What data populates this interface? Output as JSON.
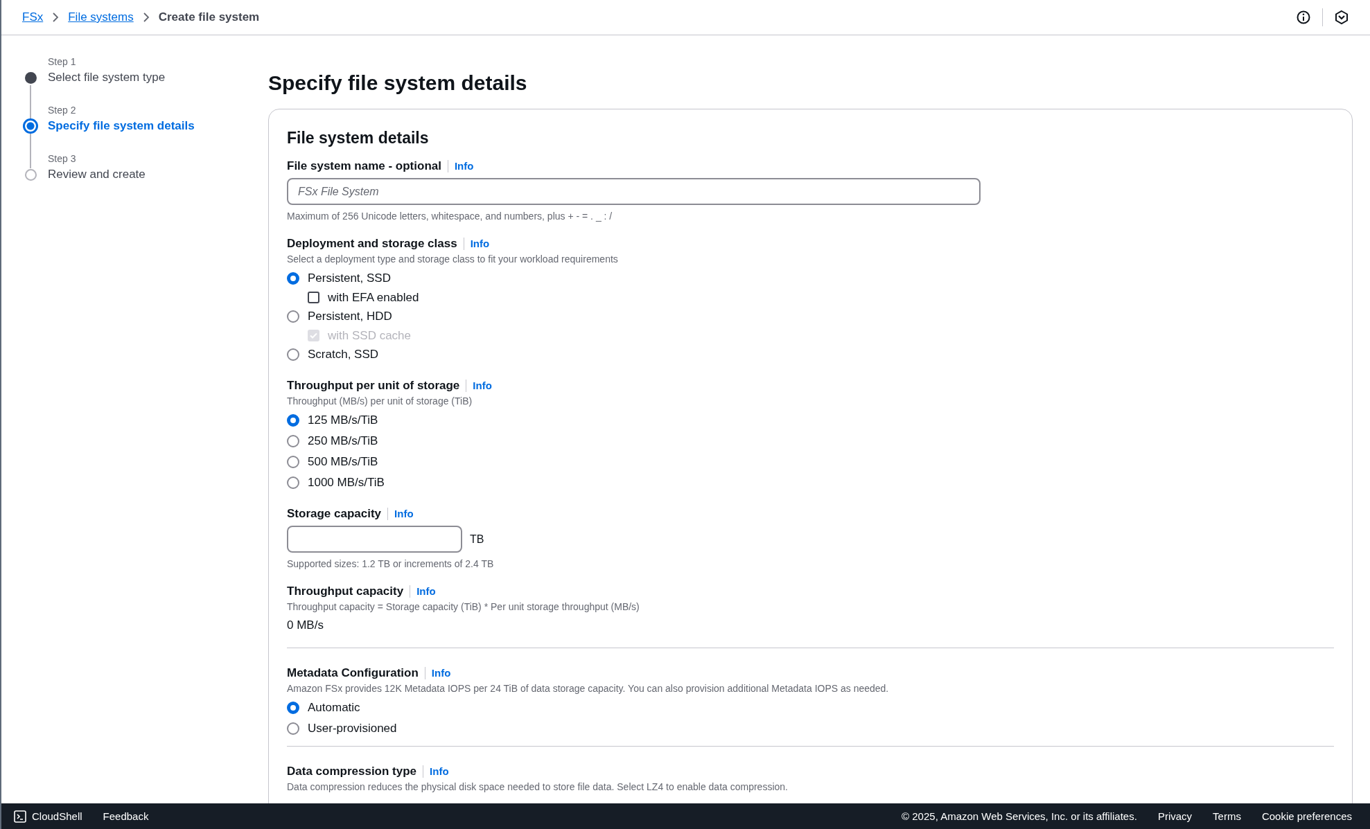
{
  "breadcrumbs": [
    {
      "label": "FSx",
      "link": true
    },
    {
      "label": "File systems",
      "link": true
    },
    {
      "label": "Create file system",
      "link": false
    }
  ],
  "steps": [
    {
      "step": "Step 1",
      "label": "Select file system type",
      "completed": true,
      "selected": false
    },
    {
      "step": "Step 2",
      "label": "Specify file system details",
      "completed": false,
      "selected": true
    },
    {
      "step": "Step 3",
      "label": "Review and create",
      "completed": false,
      "selected": false
    }
  ],
  "page_title": "Specify file system details",
  "card": {
    "title": "File system details",
    "sections": [
      {
        "kind": "text_input",
        "label": "File system name - optional",
        "info": "Info",
        "placeholder": "FSx File System",
        "wide": true,
        "hint": "Maximum of 256 Unicode letters, whitespace, and numbers, plus + - = . _ : /"
      },
      {
        "kind": "radio_group",
        "label": "Deployment and storage class",
        "info": "Info",
        "description": "Select a deployment type and storage class to fit your workload requirements",
        "options": [
          {
            "label": "Persistent, SSD",
            "selected": true,
            "sub_option": {
              "label": "with EFA enabled",
              "checked": false,
              "disabled": false
            }
          },
          {
            "label": "Persistent, HDD",
            "selected": false,
            "sub_option": {
              "label": "with SSD cache",
              "checked": true,
              "disabled": true
            }
          },
          {
            "label": "Scratch, SSD",
            "selected": false
          }
        ]
      },
      {
        "kind": "radio_group",
        "label": "Throughput per unit of storage",
        "info": "Info",
        "description": "Throughput (MB/s) per unit of storage (TiB)",
        "options": [
          {
            "label": "125 MB/s/TiB",
            "selected": true
          },
          {
            "label": "250 MB/s/TiB",
            "selected": false
          },
          {
            "label": "500 MB/s/TiB",
            "selected": false
          },
          {
            "label": "1000 MB/s/TiB",
            "selected": false
          }
        ]
      },
      {
        "kind": "text_input",
        "label": "Storage capacity",
        "info": "Info",
        "wide": false,
        "unit": "TB",
        "hint": "Supported sizes: 1.2 TB or increments of 2.4 TB"
      },
      {
        "kind": "readout",
        "label": "Throughput capacity",
        "info": "Info",
        "description": "Throughput capacity = Storage capacity (TiB) * Per unit storage throughput (MB/s)",
        "value": "0 MB/s"
      },
      {
        "kind": "divider"
      },
      {
        "kind": "radio_group",
        "label": "Metadata Configuration",
        "info": "Info",
        "description": "Amazon FSx provides 12K Metadata IOPS per 24 TiB of data storage capacity. You can also provision additional Metadata IOPS as needed.",
        "options": [
          {
            "label": "Automatic",
            "selected": true
          },
          {
            "label": "User-provisioned",
            "selected": false
          }
        ]
      },
      {
        "kind": "divider"
      },
      {
        "kind": "readout",
        "label": "Data compression type",
        "info": "Info",
        "description": "Data compression reduces the physical disk space needed to store file data. Select LZ4 to enable data compression."
      }
    ]
  },
  "footer": {
    "left": [
      "CloudShell",
      "Feedback"
    ],
    "copyright": "© 2025, Amazon Web Services, Inc. or its affiliates.",
    "links": [
      "Privacy",
      "Terms",
      "Cookie preferences"
    ]
  }
}
